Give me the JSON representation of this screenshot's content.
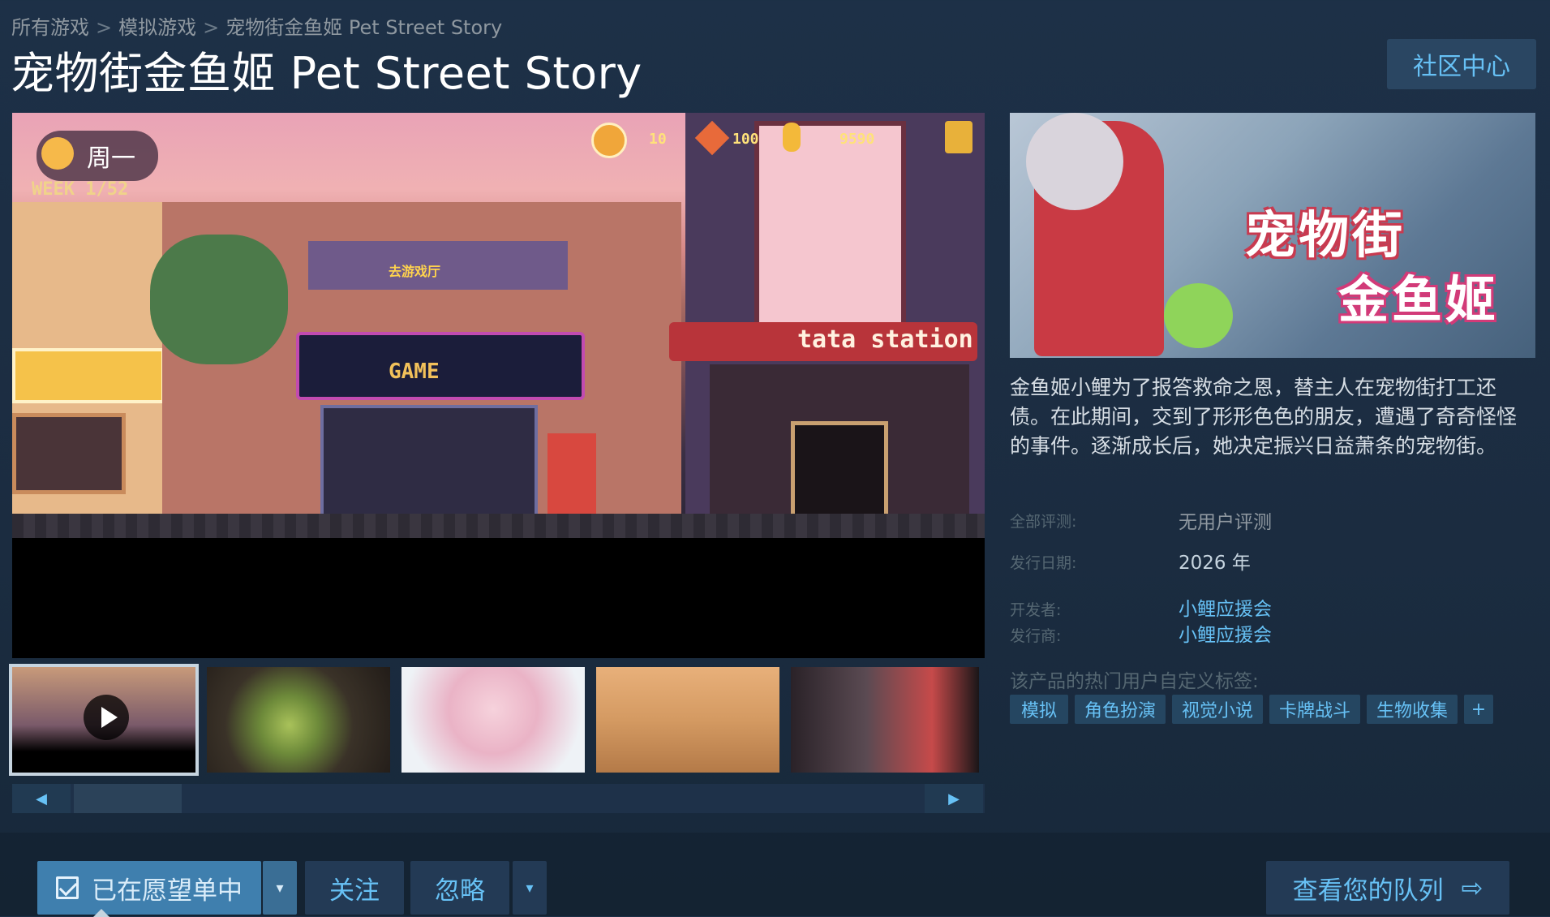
{
  "breadcrumb": {
    "items": [
      "所有游戏",
      "模拟游戏",
      "宠物街金鱼姬 Pet Street Story"
    ],
    "separator": ">"
  },
  "game": {
    "title": "宠物街金鱼姬 Pet Street Story",
    "community_hub": "社区中心"
  },
  "media": {
    "hud": {
      "day": "周一",
      "week": "WEEK 1/52",
      "clock_value": "10",
      "heart_value": "100",
      "coins_value": "9590"
    },
    "scene_signs": {
      "arcade_sign": "去游戏厅",
      "game_sign": "GAME",
      "station_sign": "tata station"
    },
    "thumbnails": [
      {
        "name": "video",
        "is_video": true,
        "selected": true
      },
      {
        "name": "forest",
        "is_video": false,
        "selected": false
      },
      {
        "name": "portrait",
        "is_video": false,
        "selected": false
      },
      {
        "name": "shop",
        "is_video": false,
        "selected": false
      },
      {
        "name": "characters",
        "is_video": false,
        "selected": false
      }
    ],
    "scroll_left": "◀",
    "scroll_right": "▶"
  },
  "capsule": {
    "logo_line1": "宠物街",
    "logo_line2": "金鱼姬"
  },
  "description": "金鱼姬小鲤为了报答救命之恩，替主人在宠物街打工还债。在此期间，交到了形形色色的朋友，遭遇了奇奇怪怪的事件。逐渐成长后，她决定振兴日益萧条的宠物街。",
  "details": {
    "reviews_label": "全部评测:",
    "reviews_value": "无用户评测",
    "release_label": "发行日期:",
    "release_value": "2026 年",
    "developer_label": "开发者:",
    "developer_value": "小鲤应援会",
    "publisher_label": "发行商:",
    "publisher_value": "小鲤应援会"
  },
  "tags": {
    "label": "该产品的热门用户自定义标签:",
    "items": [
      "模拟",
      "角色扮演",
      "视觉小说",
      "卡牌战斗",
      "生物收集",
      "+"
    ]
  },
  "actions": {
    "wishlist": "已在愿望单中",
    "wishlist_dropdown": "▾",
    "follow": "关注",
    "ignore": "忽略",
    "ignore_dropdown": "▾",
    "queue": "查看您的队列",
    "queue_arrow": "⇨"
  },
  "colors": {
    "background": "#1b2c40",
    "link": "#66c0f4",
    "button_dark": "#233a55",
    "wishlist_active": "#3f7fae"
  }
}
